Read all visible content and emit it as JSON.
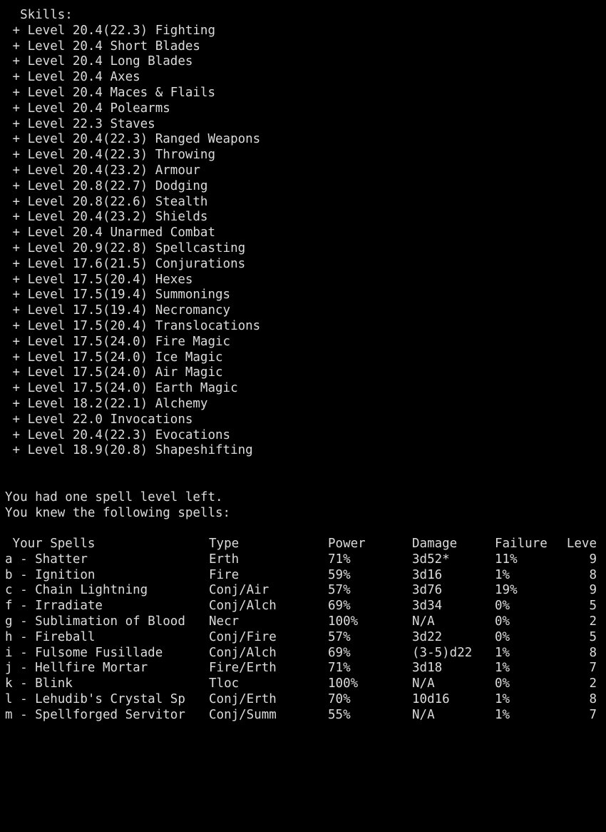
{
  "terminal": {
    "background_color": "#000000",
    "foreground_color": "#dcdcdc"
  },
  "skills": {
    "heading": "Skills:",
    "marker": "+",
    "level_word": "Level",
    "items": [
      {
        "marker": "+",
        "level": "20.4(22.3)",
        "name": "Fighting"
      },
      {
        "marker": "+",
        "level": "20.4",
        "name": "Short Blades"
      },
      {
        "marker": "+",
        "level": "20.4",
        "name": "Long Blades"
      },
      {
        "marker": "+",
        "level": "20.4",
        "name": "Axes"
      },
      {
        "marker": "+",
        "level": "20.4",
        "name": "Maces & Flails"
      },
      {
        "marker": "+",
        "level": "20.4",
        "name": "Polearms"
      },
      {
        "marker": "+",
        "level": "22.3",
        "name": "Staves"
      },
      {
        "marker": "+",
        "level": "20.4(22.3)",
        "name": "Ranged Weapons"
      },
      {
        "marker": "+",
        "level": "20.4(22.3)",
        "name": "Throwing"
      },
      {
        "marker": "+",
        "level": "20.4(23.2)",
        "name": "Armour"
      },
      {
        "marker": "+",
        "level": "20.8(22.7)",
        "name": "Dodging"
      },
      {
        "marker": "+",
        "level": "20.8(22.6)",
        "name": "Stealth"
      },
      {
        "marker": "+",
        "level": "20.4(23.2)",
        "name": "Shields"
      },
      {
        "marker": "+",
        "level": "20.4",
        "name": "Unarmed Combat"
      },
      {
        "marker": "+",
        "level": "20.9(22.8)",
        "name": "Spellcasting"
      },
      {
        "marker": "+",
        "level": "17.6(21.5)",
        "name": "Conjurations"
      },
      {
        "marker": "+",
        "level": "17.5(20.4)",
        "name": "Hexes"
      },
      {
        "marker": "+",
        "level": "17.5(19.4)",
        "name": "Summonings"
      },
      {
        "marker": "+",
        "level": "17.5(19.4)",
        "name": "Necromancy"
      },
      {
        "marker": "+",
        "level": "17.5(20.4)",
        "name": "Translocations"
      },
      {
        "marker": "+",
        "level": "17.5(24.0)",
        "name": "Fire Magic"
      },
      {
        "marker": "+",
        "level": "17.5(24.0)",
        "name": "Ice Magic"
      },
      {
        "marker": "+",
        "level": "17.5(24.0)",
        "name": "Air Magic"
      },
      {
        "marker": "+",
        "level": "17.5(24.0)",
        "name": "Earth Magic"
      },
      {
        "marker": "+",
        "level": "18.2(22.1)",
        "name": "Alchemy"
      },
      {
        "marker": "+",
        "level": "22.0",
        "name": "Invocations"
      },
      {
        "marker": "+",
        "level": "20.4(22.3)",
        "name": "Evocations"
      },
      {
        "marker": "+",
        "level": "18.9(20.8)",
        "name": "Shapeshifting"
      }
    ],
    "lines": [
      "  Skills:",
      " + Level 20.4(22.3) Fighting",
      " + Level 20.4 Short Blades",
      " + Level 20.4 Long Blades",
      " + Level 20.4 Axes",
      " + Level 20.4 Maces & Flails",
      " + Level 20.4 Polearms",
      " + Level 22.3 Staves",
      " + Level 20.4(22.3) Ranged Weapons",
      " + Level 20.4(22.3) Throwing",
      " + Level 20.4(23.2) Armour",
      " + Level 20.8(22.7) Dodging",
      " + Level 20.8(22.6) Stealth",
      " + Level 20.4(23.2) Shields",
      " + Level 20.4 Unarmed Combat",
      " + Level 20.9(22.8) Spellcasting",
      " + Level 17.6(21.5) Conjurations",
      " + Level 17.5(20.4) Hexes",
      " + Level 17.5(19.4) Summonings",
      " + Level 17.5(19.4) Necromancy",
      " + Level 17.5(20.4) Translocations",
      " + Level 17.5(24.0) Fire Magic",
      " + Level 17.5(24.0) Ice Magic",
      " + Level 17.5(24.0) Air Magic",
      " + Level 17.5(24.0) Earth Magic",
      " + Level 18.2(22.1) Alchemy",
      " + Level 22.0 Invocations",
      " + Level 20.4(22.3) Evocations",
      " + Level 18.9(20.8) Shapeshifting"
    ]
  },
  "messages": {
    "line1": "You had one spell level left.",
    "line2": "You knew the following spells:"
  },
  "spell_table": {
    "headers": {
      "name": " Your Spells",
      "type": "Type",
      "power": "Power",
      "damage": "Damage",
      "failure": "Failure",
      "level": "Leve"
    },
    "rows": [
      {
        "letter": "a",
        "name": "a - Shatter",
        "type": "Erth",
        "power": "71%",
        "damage": "3d52*",
        "failure": "11%",
        "level": "9"
      },
      {
        "letter": "b",
        "name": "b - Ignition",
        "type": "Fire",
        "power": "59%",
        "damage": "3d16",
        "failure": "1%",
        "level": "8"
      },
      {
        "letter": "c",
        "name": "c - Chain Lightning",
        "type": "Conj/Air",
        "power": "57%",
        "damage": "3d76",
        "failure": "19%",
        "level": "9"
      },
      {
        "letter": "f",
        "name": "f - Irradiate",
        "type": "Conj/Alch",
        "power": "69%",
        "damage": "3d34",
        "failure": "0%",
        "level": "5"
      },
      {
        "letter": "g",
        "name": "g - Sublimation of Blood",
        "type": "Necr",
        "power": "100%",
        "damage": "N/A",
        "failure": "0%",
        "level": "2"
      },
      {
        "letter": "h",
        "name": "h - Fireball",
        "type": "Conj/Fire",
        "power": "57%",
        "damage": "3d22",
        "failure": "0%",
        "level": "5"
      },
      {
        "letter": "i",
        "name": "i - Fulsome Fusillade",
        "type": "Conj/Alch",
        "power": "69%",
        "damage": "(3-5)d22",
        "failure": "1%",
        "level": "8"
      },
      {
        "letter": "j",
        "name": "j - Hellfire Mortar",
        "type": "Fire/Erth",
        "power": "71%",
        "damage": "3d18",
        "failure": "1%",
        "level": "7"
      },
      {
        "letter": "k",
        "name": "k - Blink",
        "type": "Tloc",
        "power": "100%",
        "damage": "N/A",
        "failure": "0%",
        "level": "2"
      },
      {
        "letter": "l",
        "name": "l - Lehudib's Crystal Sp",
        "type": "Conj/Erth",
        "power": "70%",
        "damage": "10d16",
        "failure": "1%",
        "level": "8"
      },
      {
        "letter": "m",
        "name": "m - Spellforged Servitor",
        "type": "Conj/Summ",
        "power": "55%",
        "damage": "N/A",
        "failure": "1%",
        "level": "7"
      }
    ]
  }
}
